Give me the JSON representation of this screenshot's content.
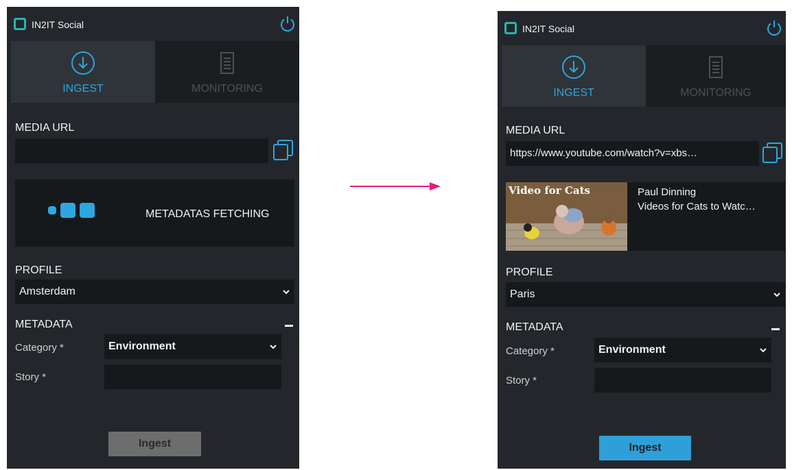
{
  "colors": {
    "panel_bg": "#23272b",
    "field_bg": "#16191c",
    "accent_blue": "#2ea6e0",
    "logo_teal": "#2bb3b0",
    "arrow_pink": "#e8197d",
    "disabled_button": "#6d6d6d"
  },
  "before": {
    "app_title": "IN2IT Social",
    "tabs": [
      {
        "label": "INGEST",
        "icon": "download-circle-icon",
        "active": true
      },
      {
        "label": "MONITORING",
        "icon": "document-icon",
        "active": false
      }
    ],
    "media_url_label": "MEDIA URL",
    "media_url_value": "",
    "metadata_status": "METADATAS FETCHING",
    "profile_label": "PROFILE",
    "profile_value": "Amsterdam",
    "metadata_label": "METADATA",
    "category_label": "Category *",
    "category_value": "Environment",
    "story_label": "Story *",
    "story_value": "",
    "ingest_button": "Ingest",
    "ingest_enabled": false
  },
  "after": {
    "app_title": "IN2IT Social",
    "tabs": [
      {
        "label": "INGEST",
        "icon": "download-circle-icon",
        "active": true
      },
      {
        "label": "MONITORING",
        "icon": "document-icon",
        "active": false
      }
    ],
    "media_url_label": "MEDIA URL",
    "media_url_value": "https://www.youtube.com/watch?v=xbs…",
    "video": {
      "thumbnail_caption": "Video for Cats",
      "author": "Paul Dinning",
      "title": "Videos for Cats to Watc…"
    },
    "profile_label": "PROFILE",
    "profile_value": "Paris",
    "metadata_label": "METADATA",
    "category_label": "Category *",
    "category_value": "Environment",
    "story_label": "Story *",
    "story_value": "",
    "ingest_button": "Ingest",
    "ingest_enabled": true
  }
}
